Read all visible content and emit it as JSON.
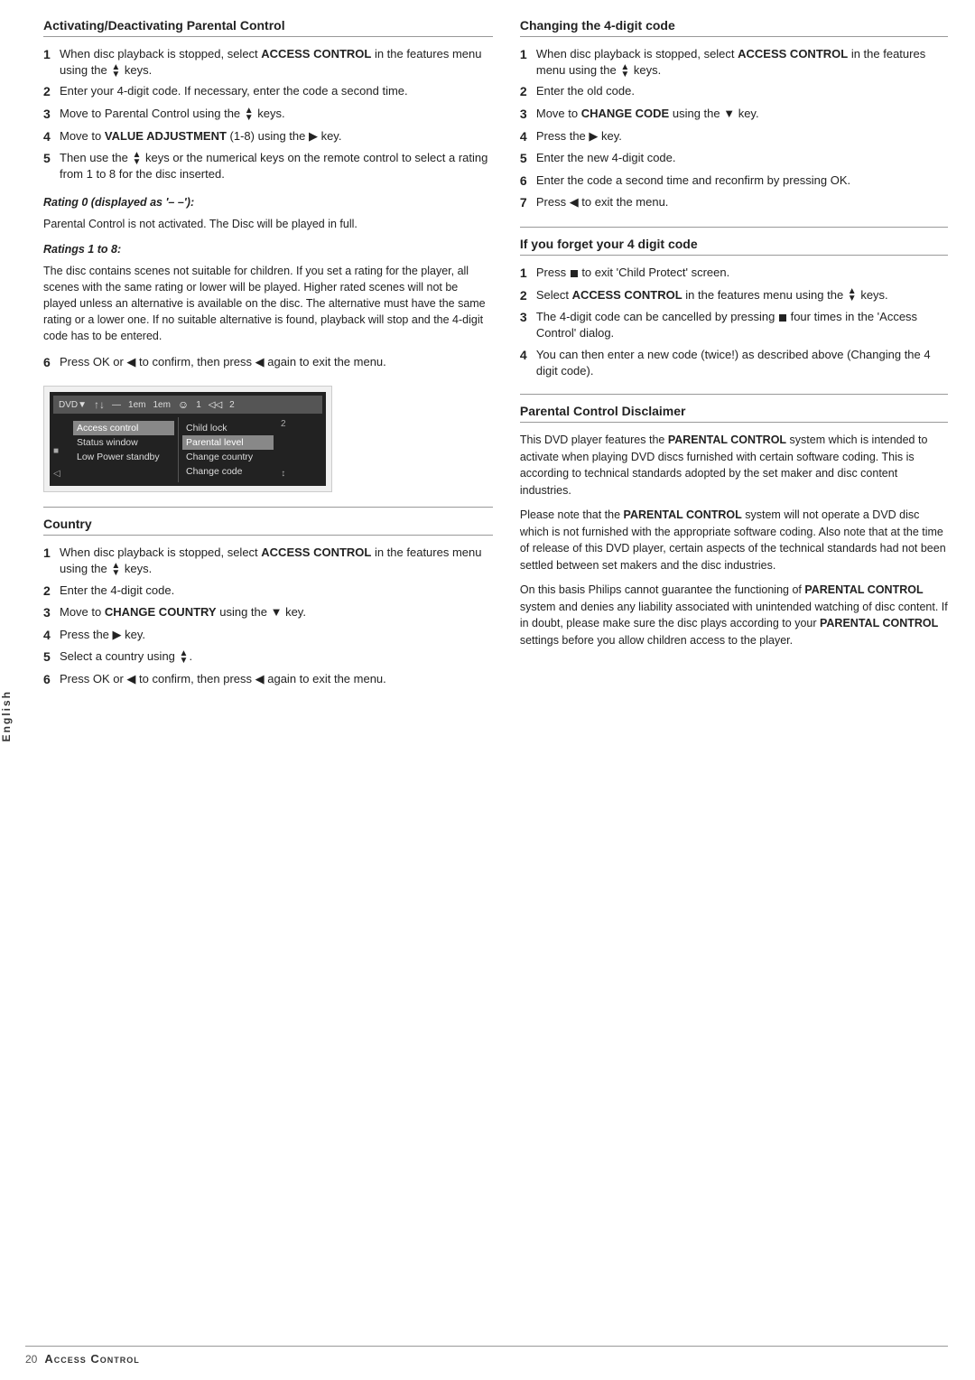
{
  "sidebar": {
    "label": "English"
  },
  "footer": {
    "page": "20",
    "title": "Access Control"
  },
  "left_col": {
    "section1": {
      "title": "Activating/Deactivating Parental Control",
      "steps": [
        {
          "num": "1",
          "text_parts": [
            {
              "text": "When disc playback is stopped, select "
            },
            {
              "text": "ACCESS CONTROL",
              "bold": true
            },
            {
              "text": " in the features menu using the ▲/▼ keys."
            }
          ]
        },
        {
          "num": "2",
          "text": "Enter your 4-digit code. If necessary, enter the code a second time."
        },
        {
          "num": "3",
          "text_parts": [
            {
              "text": "Move to Parental Control using the ▲/▼ keys."
            }
          ]
        },
        {
          "num": "4",
          "text_parts": [
            {
              "text": "Move to "
            },
            {
              "text": "VALUE ADJUSTMENT",
              "bold": true
            },
            {
              "text": " (1-8) using the ▶ key."
            }
          ]
        },
        {
          "num": "5",
          "text": "Then use the ▲/▼ keys or the numerical keys on the remote control to select a rating from 1 to 8 for the disc inserted."
        }
      ],
      "notes": [
        {
          "title": "Rating 0 (displayed as '– –'):",
          "text": "Parental Control is not activated. The Disc will be played in full."
        },
        {
          "title": "Ratings 1 to 8:",
          "text": "The disc contains scenes not suitable for children. If you set a rating for the player, all scenes with the same rating or lower will be played. Higher rated scenes will not be played unless an alternative is available on the disc. The alternative must have the same rating or a lower one. If no suitable alternative is found, playback will stop and the 4-digit code has to be entered."
        }
      ],
      "step6": {
        "num": "6",
        "text": "Press OK or ◀ to confirm, then press ◀ again to exit the menu."
      }
    },
    "section2": {
      "title": "Country",
      "steps": [
        {
          "num": "1",
          "text_parts": [
            {
              "text": "When disc playback is stopped, select "
            },
            {
              "text": "ACCESS CONTROL",
              "bold": true
            },
            {
              "text": " in the features menu using the ▲/▼ keys."
            }
          ]
        },
        {
          "num": "2",
          "text": "Enter the 4-digit code."
        },
        {
          "num": "3",
          "text_parts": [
            {
              "text": "Move to "
            },
            {
              "text": "CHANGE COUNTRY",
              "bold": true
            },
            {
              "text": " using the ▼ key."
            }
          ]
        },
        {
          "num": "4",
          "text": "Press the ▶ key."
        },
        {
          "num": "5",
          "text": "Select a country using ▲/▼."
        },
        {
          "num": "6",
          "text": "Press OK or ◀ to confirm, then press ◀ again to exit the menu."
        }
      ]
    }
  },
  "right_col": {
    "section1": {
      "title": "Changing the 4-digit code",
      "steps": [
        {
          "num": "1",
          "text_parts": [
            {
              "text": "When disc playback is stopped, select "
            },
            {
              "text": "ACCESS CONTROL",
              "bold": true
            },
            {
              "text": " in the features menu using the ▲/▼ keys."
            }
          ]
        },
        {
          "num": "2",
          "text": "Enter the old code."
        },
        {
          "num": "3",
          "text_parts": [
            {
              "text": "Move to "
            },
            {
              "text": "CHANGE CODE",
              "bold": true
            },
            {
              "text": " using the ▼ key."
            }
          ]
        },
        {
          "num": "4",
          "text": "Press the ▶ key."
        },
        {
          "num": "5",
          "text": "Enter the new 4-digit code."
        },
        {
          "num": "6",
          "text": "Enter the code a second time and reconfirm by pressing OK."
        },
        {
          "num": "7",
          "text": "Press ◀ to exit the menu."
        }
      ]
    },
    "section2": {
      "title": "If you forget your 4 digit code",
      "steps": [
        {
          "num": "1",
          "text_parts": [
            {
              "text": "Press ■ to exit 'Child Protect' screen."
            }
          ]
        },
        {
          "num": "2",
          "text_parts": [
            {
              "text": "Select "
            },
            {
              "text": "ACCESS CONTROL",
              "bold": true
            },
            {
              "text": " in the features menu using the ▲/▼ keys."
            }
          ]
        },
        {
          "num": "3",
          "text": "The 4-digit code can be cancelled by pressing ■ four times in the 'Access Control' dialog."
        },
        {
          "num": "4",
          "text": "You can then enter a new code (twice!) as described above (Changing the 4 digit code)."
        }
      ]
    },
    "section3": {
      "title": "Parental Control Disclaimer",
      "paragraphs": [
        "This DVD player features the PARENTAL CONTROL system which is intended to activate when playing DVD discs furnished with certain software coding. This is according to technical standards adopted by the set maker and disc content industries.",
        "Please note that the PARENTAL CONTROL system will not operate a DVD disc which is not furnished with the appropriate software coding. Also note that at the time of release of this DVD player, certain aspects of the technical standards had not been settled between set makers and the disc industries.",
        "On this basis Philips cannot guarantee the functioning of PARENTAL CONTROL system and denies any liability associated with unintended watching of disc content. If in doubt, please make sure the disc plays according to your PARENTAL CONTROL settings before you allow children access to the player."
      ],
      "bold_words": [
        "PARENTAL CONTROL",
        "PARENTAL CONTROL",
        "PARENTAL CONTROL",
        "PARENTAL CONTROL"
      ]
    }
  },
  "dvd_menu": {
    "top_icons": [
      "DVD▼",
      "▲",
      "═",
      "1em",
      "1em",
      "☺",
      "1",
      "◁◁",
      "2"
    ],
    "col1_items": [
      {
        "label": "Access control",
        "highlighted": true
      },
      {
        "label": "Status window"
      },
      {
        "label": "Low Power standby"
      }
    ],
    "col2_items": [
      {
        "label": "Child lock"
      },
      {
        "label": "Parental level",
        "highlighted": true
      },
      {
        "label": "Change country"
      },
      {
        "label": "Change code"
      }
    ],
    "side_num": "2",
    "left_icon": "◁"
  }
}
